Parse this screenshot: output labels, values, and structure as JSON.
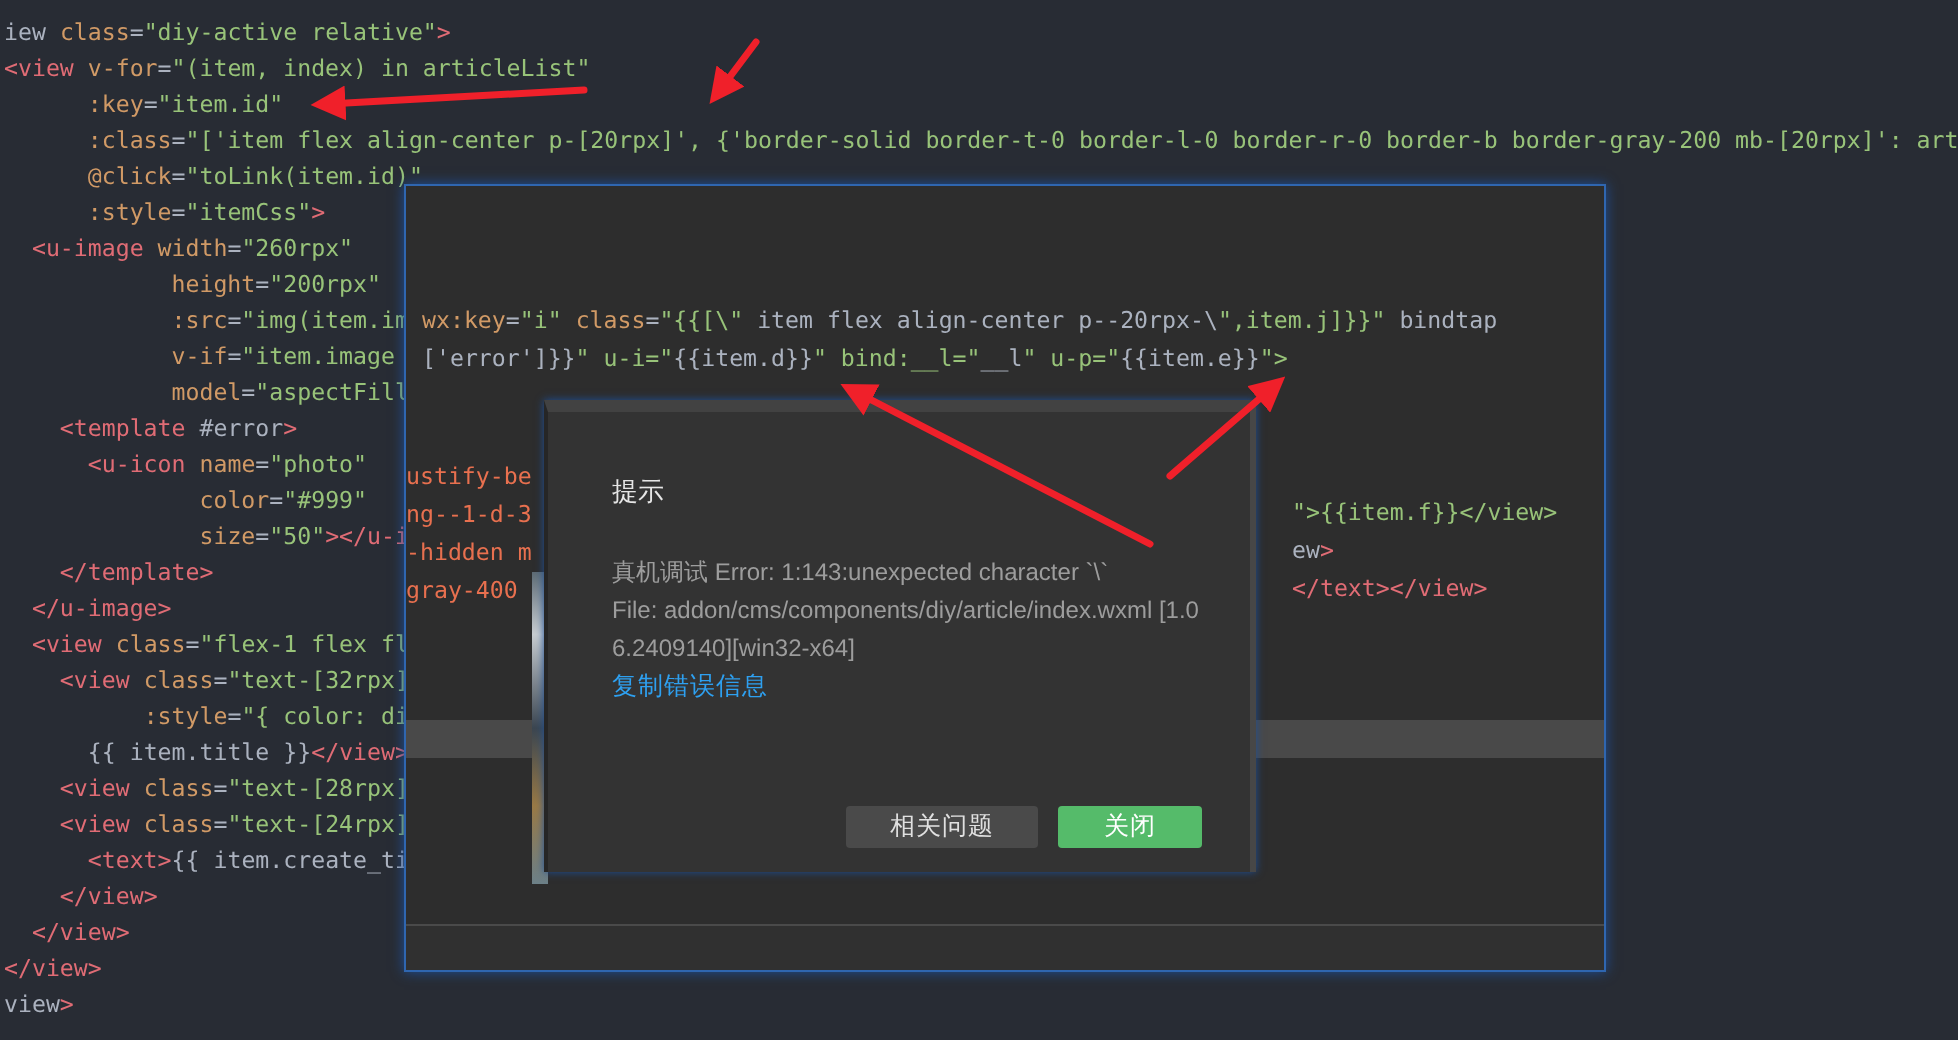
{
  "editor": {
    "lines": [
      "iew class=\"diy-active relative\">",
      "<view v-for=\"(item, index) in articleList\"",
      "      :key=\"item.id\"",
      "      :class=\"['item flex align-center p-[20rpx]', {'border-solid border-t-0 border-l-0 border-r-0 border-b border-gray-200 mb-[20rpx]': art",
      "      @click=\"toLink(item.id)\"",
      "      :style=\"itemCss\">",
      "  <u-image width=\"260rpx\"",
      "            height=\"200rpx\"",
      "            :src=\"img(item.im",
      "            v-if=\"item.image",
      "            model=\"aspectFill",
      "    <template #error>",
      "      <u-icon name=\"photo\"",
      "              color=\"#999\"",
      "              size=\"50\"></u-i",
      "    </template>",
      "  </u-image>",
      "  <view class=\"flex-1 flex fl",
      "    <view class=\"text-[32rpx]",
      "          :style=\"{ color: di",
      "      {{ item.title }}</view>",
      "    <view class=\"text-[28rpx]",
      "    <view class=\"text-[24rpx]",
      "      <text>{{ item.create_ti",
      "    </view>",
      "  </view>",
      "</view>",
      "view>"
    ]
  },
  "debug_window": {
    "code_lines": [
      "wx:key=\"i\" class=\"{{[\\\" item flex align-center p--20rpx-\\\",item.j]}}\" bindtap",
      "['error']}}\" u-i=\"{{item.d}}\" bind:__l=\"__l\" u-p=\"{{item.e}}\">"
    ],
    "left_fragments": [
      "ustify-be",
      "ng--1-d-3",
      "-hidden m",
      "gray-400"
    ],
    "right_fragments": [
      "\">{{item.f}}</view>",
      "ew>",
      "</text></view>"
    ]
  },
  "dialog": {
    "title": "提示",
    "message_lines": [
      "真机调试 Error: 1:143:unexpected character `\\`",
      "File: addon/cms/components/diy/article/index.wxml [1.0",
      "6.2409140][win32-x64]"
    ],
    "link": "复制错误信息",
    "buttons": [
      {
        "label": "相关问题",
        "kind": "secondary"
      },
      {
        "label": "关闭",
        "kind": "primary"
      }
    ]
  }
}
